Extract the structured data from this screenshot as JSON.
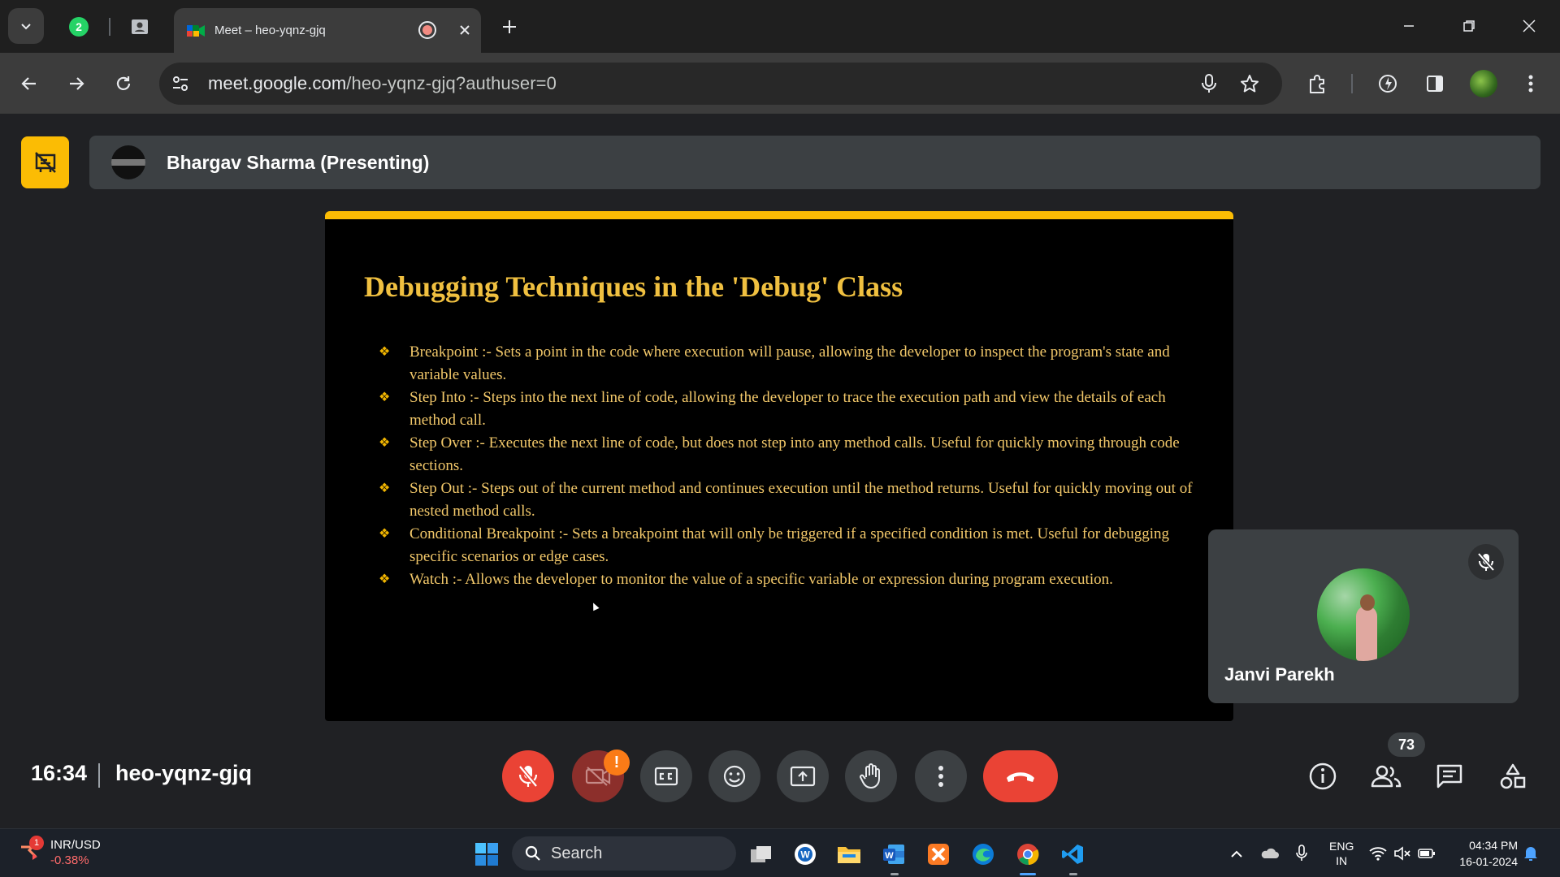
{
  "browser": {
    "pinned_tab_badge": "2",
    "active_tab": {
      "title": "Meet – heo-yqnz-gjq"
    },
    "url_host": "meet.google.com",
    "url_rest": "/heo-yqnz-gjq?authuser=0"
  },
  "meet": {
    "presenter": "Bhargav Sharma (Presenting)",
    "meeting_time": "16:34",
    "meeting_code": "heo-yqnz-gjq",
    "people_count": "73",
    "camera_warning": "!",
    "participant": {
      "name": "Janvi Parekh"
    },
    "colors": {
      "accent_yellow": "#fbbc04",
      "end_call": "#ea4335",
      "background": "#202124"
    }
  },
  "slide": {
    "title": "Debugging Techniques in the 'Debug' Class",
    "bullet_symbol": "❖",
    "items": [
      "Breakpoint :- Sets a point in the code where execution will pause, allowing the developer to inspect the program's state and variable values.",
      "Step Into :- Steps into the next line of code, allowing the developer to trace the execution path and view the details of each method call.",
      "Step Over :- Executes the next line of code, but does not step into any method calls. Useful for quickly moving through code sections.",
      "Step Out :- Steps out of the current method and continues execution until the method returns. Useful for quickly moving out of nested method calls.",
      "Conditional Breakpoint :- Sets a breakpoint that will only be triggered if a specified condition is met. Useful for debugging specific scenarios or edge cases.",
      "Watch :- Allows the developer to monitor the value of a specific variable or expression during program execution."
    ]
  },
  "taskbar": {
    "widget_badge": "1",
    "widget_title": "INR/USD",
    "widget_value": "-0.38%",
    "search_label": "Search",
    "lang_top": "ENG",
    "lang_bottom": "IN",
    "time": "04:34 PM",
    "date": "16-01-2024"
  }
}
